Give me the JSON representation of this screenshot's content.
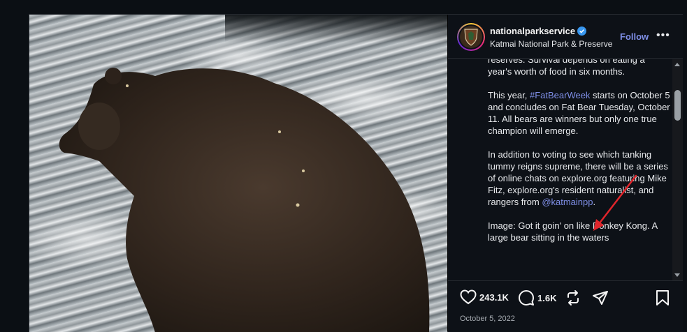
{
  "post": {
    "username": "nationalparkservice",
    "location": "Katmai National Park & Preserve",
    "follow_label": "Follow",
    "more_label": "•••",
    "caption": {
      "p1": "reserves. Survival depends on eating a year's worth of food in six months.",
      "p2_before": "This year, ",
      "p2_tag": "#FatBearWeek",
      "p2_after": " starts on October 5 and concludes on Fat Bear Tuesday, October 11. All bears are winners but only one true champion will emerge.",
      "p3_before": "In addition to voting to see which tanking tummy reigns supreme, there will be a series of online chats on explore.org featuring Mike Fitz, explore.org's resident naturalist, and rangers from ",
      "p3_mention": "@katmainpp",
      "p3_after": ".",
      "p4": "Image: Got it goin' on like Donkey Kong. A large bear sitting in the waters"
    },
    "likes_count": "243.1K",
    "comments_count": "1.6K",
    "date": "October 5, 2022"
  },
  "colors": {
    "accent": "#7f8fe7",
    "annotation_arrow": "#e0252b",
    "verified": "#3897f0"
  },
  "icons": {
    "verified": "verified-badge-icon",
    "like": "heart-icon",
    "comment": "comment-icon",
    "repost": "repost-icon",
    "share": "send-icon",
    "save": "bookmark-icon"
  }
}
